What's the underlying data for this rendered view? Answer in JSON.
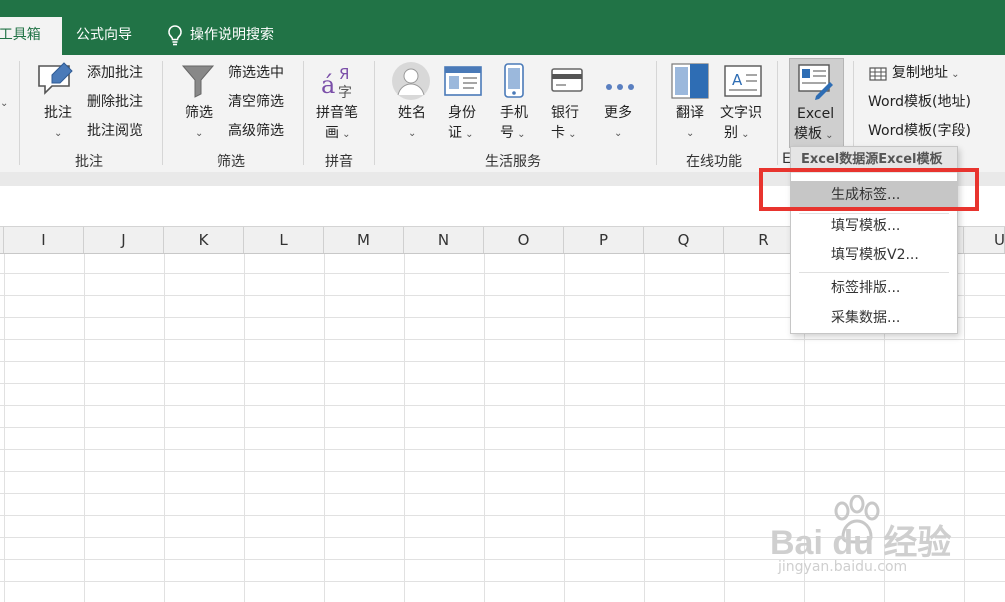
{
  "ribbon_tabs": [
    "/工具箱",
    "公式向导",
    "操作说明搜索"
  ],
  "groups": {
    "comment": {
      "label": "批注",
      "main_button": "批注",
      "items": [
        "添加批注",
        "删除批注",
        "批注阅览"
      ]
    },
    "filter": {
      "label": "筛选",
      "main_button": "筛选",
      "items": [
        "筛选选中",
        "清空筛选",
        "高级筛选"
      ]
    },
    "pinyin": {
      "label": "拼音",
      "button_line1": "拼音笔",
      "button_line2": "画"
    },
    "life": {
      "label": "生活服务",
      "buttons": [
        {
          "line1": "姓名",
          "line2": ""
        },
        {
          "line1": "身份",
          "line2": "证"
        },
        {
          "line1": "手机",
          "line2": "号"
        },
        {
          "line1": "银行",
          "line2": "卡"
        },
        {
          "line1": "更多",
          "line2": ""
        }
      ]
    },
    "online": {
      "label": "在线功能",
      "buttons": [
        {
          "line1": "翻译",
          "line2": ""
        },
        {
          "line1": "文字识",
          "line2": "别"
        }
      ]
    },
    "excel_template": {
      "label": "E",
      "line1": "Excel",
      "line2": "模板"
    },
    "word_template": {
      "items": [
        "复制地址",
        "Word模板(地址)",
        "Word模板(字段)"
      ]
    }
  },
  "columns": [
    "I",
    "J",
    "K",
    "L",
    "M",
    "N",
    "O",
    "P",
    "Q",
    "R",
    "U"
  ],
  "dropdown": {
    "header": "Excel数据源Excel模板",
    "items": [
      "生成标签...",
      "填写模板...",
      "填写模板V2...",
      "标签排版...",
      "采集数据..."
    ]
  },
  "watermark": {
    "logo": "Bai du 经验",
    "url": "jingyan.baidu.com"
  },
  "colors": {
    "excel_green": "#217346",
    "highlight_red": "#e8342e"
  }
}
